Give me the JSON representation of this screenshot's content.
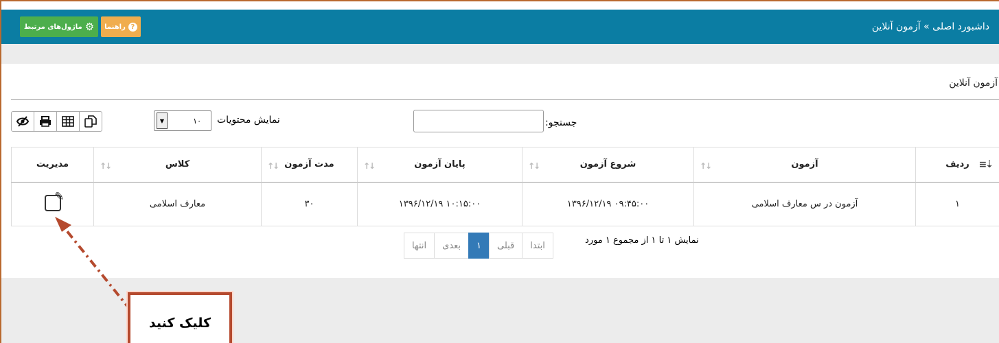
{
  "header": {
    "breadcrumb": "داشبورد اصلی » آزمون آنلاین",
    "modules_button": "ماژول‌های مرتبط",
    "help_button": "راهنما"
  },
  "panel": {
    "title": "آزمون آنلاین",
    "search_label": "جستجو:",
    "search_value": "",
    "show_label": "نمایش محتویات",
    "page_size": "۱۰",
    "toolbar_icons": [
      "eye-slash-icon",
      "print-icon",
      "table-icon",
      "copy-icon"
    ]
  },
  "table": {
    "columns": [
      "ردیف",
      "آزمون",
      "شروع آزمون",
      "پایان آزمون",
      "مدت آزمون",
      "کلاس",
      "مدیریت"
    ],
    "rows": [
      {
        "index": "۱",
        "exam": "آزمون در س معارف اسلامی",
        "start": "۱۳۹۶/۱۲/۱۹ ۰۹:۴۵:۰۰",
        "end": "۱۳۹۶/۱۲/۱۹ ۱۰:۱۵:۰۰",
        "duration": "۳۰",
        "class": "معارف اسلامی",
        "manage_icon": "edit-icon"
      }
    ]
  },
  "pagination": {
    "info": "نمایش ۱ تا ۱ از مجموع ۱ مورد",
    "first": "ابتدا",
    "prev": "قبلی",
    "current": "۱",
    "next": "بعدی",
    "last": "انتها"
  },
  "annotation": {
    "callout_text": "کلیک کنید",
    "color": "#b54a2e"
  }
}
